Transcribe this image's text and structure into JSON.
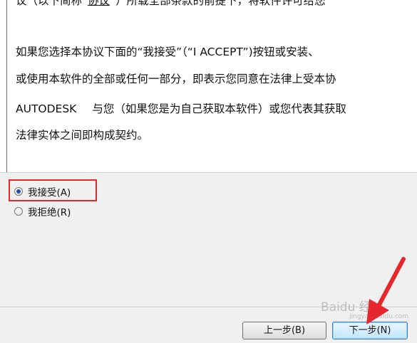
{
  "license": {
    "line0_before": "议（以下简称“",
    "line0_term": "协议",
    "line0_after": "”）所载全部条款的前提下，将软件许可给您",
    "line1": "如果您选择本协议下面的“我接受”（“I ACCEPT”)按钮或安装、",
    "line2": "或使用本软件的全部或任何一部分，即表示您同意在法律上受本协",
    "line3_company": "AUTODESK",
    "line3_rest": "与您（如果您是为自己获取本软件）或您代表其获取",
    "line4": "法律实体之间即构成契约。"
  },
  "options": {
    "accept_label": "我接受(A)",
    "reject_label": "我拒绝(R)",
    "selected": "accept"
  },
  "buttons": {
    "back_label": "上一步(B)",
    "next_label": "下一步(N)"
  },
  "watermark": {
    "text": "Baidu 经验",
    "sub": "jingyan.baidu.com"
  },
  "colors": {
    "highlight": "#e5262d",
    "arrow": "#e5262d",
    "radio_dot": "#1f4fa8"
  }
}
